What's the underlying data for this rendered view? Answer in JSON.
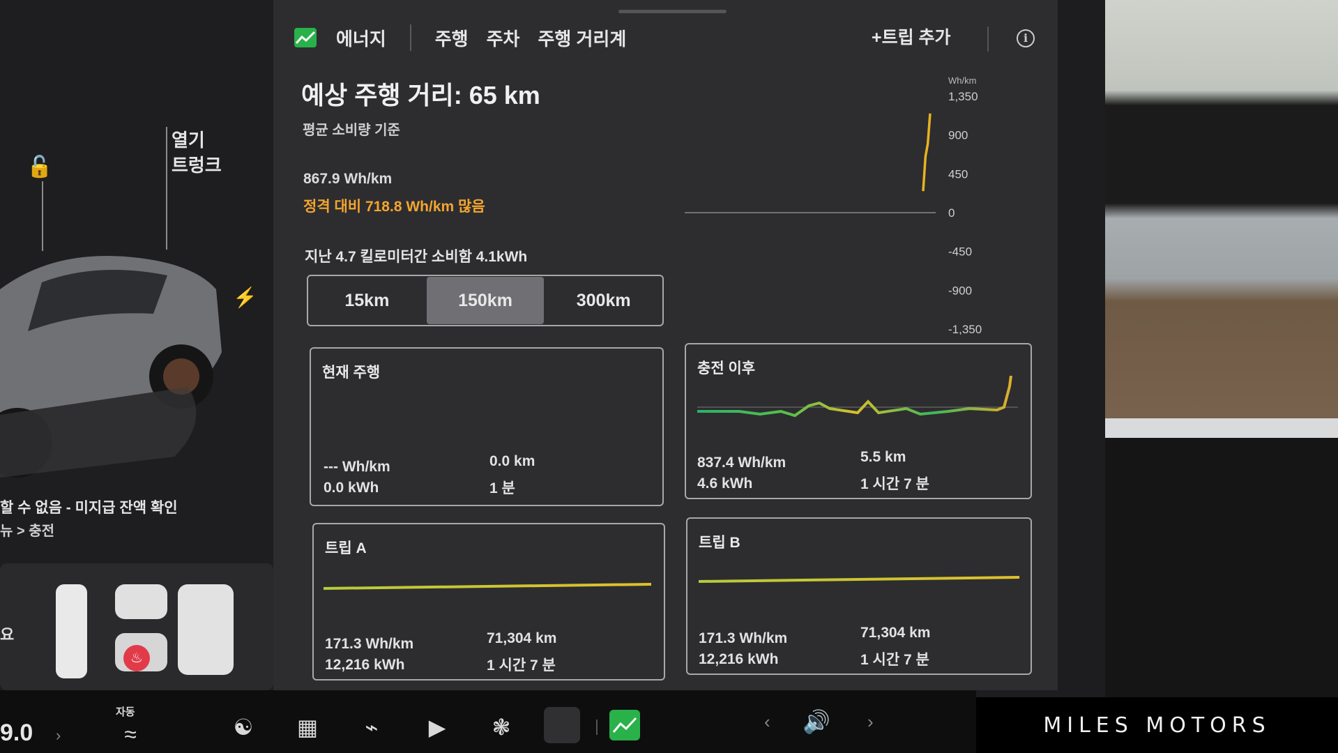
{
  "tabs": {
    "energy": "에너지",
    "drive": "주행",
    "park": "주차",
    "trip_odometer": "주행 거리계"
  },
  "header": {
    "add_trip": "+트립 추가",
    "info": "i"
  },
  "summary": {
    "estimated_range": "예상 주행 거리: 65 km",
    "basis": "평균 소비량 기준",
    "avg_consumption": "867.9 Wh/km",
    "rated_diff": "정격 대비 718.8 Wh/km 많음",
    "recent": "지난 4.7 킬로미터간 소비함 4.1kWh"
  },
  "range_selector": {
    "options": [
      "15km",
      "150km",
      "300km"
    ],
    "selected": "150km"
  },
  "chart_data": {
    "type": "line",
    "ylabel": "Wh/km",
    "yticks": [
      "1,350",
      "900",
      "450",
      "0",
      "-450",
      "-900",
      "-1,350"
    ],
    "ylim": [
      -1350,
      1350
    ],
    "x": [
      0.0,
      0.1,
      0.2,
      0.3
    ],
    "series": [
      {
        "values": [
          250,
          650,
          800,
          1150
        ]
      }
    ]
  },
  "cards": {
    "current_drive": {
      "title": "현재 주행",
      "consumption": "--- Wh/km",
      "energy": "0.0 kWh",
      "distance": "0.0 km",
      "time": "1 분"
    },
    "since_charge": {
      "title": "충전 이후",
      "consumption": "837.4 Wh/km",
      "energy": "4.6 kWh",
      "distance": "5.5 km",
      "time": "1 시간 7 분"
    },
    "trip_a": {
      "title": "트립 A",
      "consumption": "171.3 Wh/km",
      "energy": "12,216 kWh",
      "distance": "71,304 km",
      "time": "1 시간 7 분"
    },
    "trip_b": {
      "title": "트립 B",
      "consumption": "171.3 Wh/km",
      "energy": "12,216 kWh",
      "distance": "71,304 km",
      "time": "1 시간 7 분"
    }
  },
  "vehicle": {
    "trunk_label_1": "열기",
    "trunk_label_2": "트렁크",
    "warning": "할 수 없음 - 미지급 잔액 확인",
    "menu_path": "뉴 > 충전",
    "seat_label": "요"
  },
  "dock": {
    "temperature": "9.0",
    "auto_label": "자동"
  },
  "watermark": "MILES MOTORS",
  "colors": {
    "accent_green": "#29b14a",
    "warning_orange": "#f5a52d",
    "heat_red": "#e13b4a"
  }
}
